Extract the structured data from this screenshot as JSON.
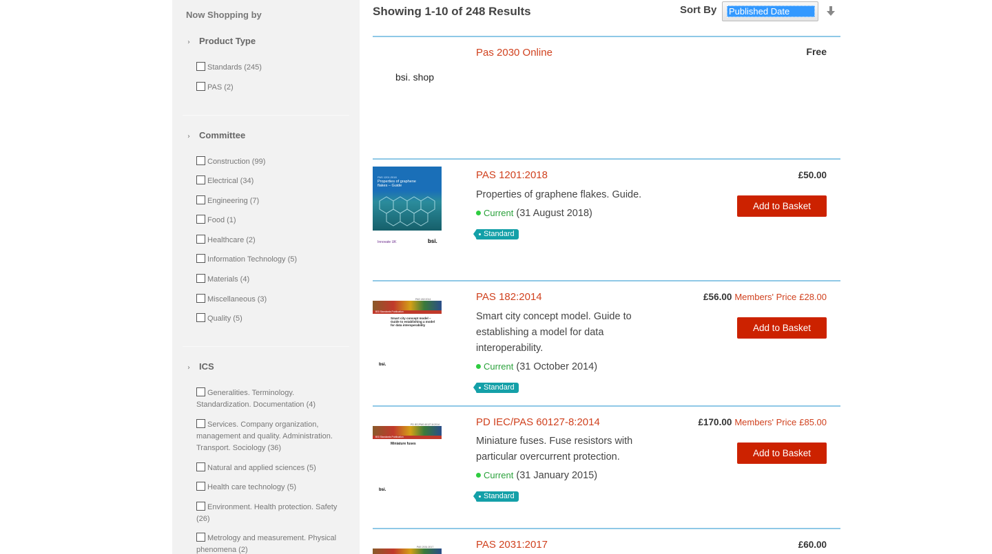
{
  "sidebar": {
    "heading": "Now Shopping by",
    "facets": [
      {
        "title": "Product Type",
        "options": [
          "Standards (245)",
          "PAS (2)"
        ]
      },
      {
        "title": "Committee",
        "options": [
          "Construction (99)",
          "Electrical (34)",
          "Engineering (7)",
          "Food (1)",
          "Healthcare (2)",
          "Information Technology (5)",
          "Materials (4)",
          "Miscellaneous (3)",
          "Quality (5)"
        ]
      },
      {
        "title": "ICS",
        "options": [
          "Generalities. Terminology. Standardization. Documentation (4)",
          "Services. Company organization, management and quality. Administration. Transport. Sociology (36)",
          "Natural and applied sciences (5)",
          "Health care technology (5)",
          "Environment. Health protection. Safety (26)",
          "Metrology and measurement. Physical phenomena (2)"
        ]
      }
    ]
  },
  "header": {
    "results": "Showing 1-10 of 248 Results",
    "sort_label": "Sort By",
    "sort_value": "Published Date"
  },
  "results": [
    {
      "title": "Pas 2030 Online",
      "price": "Free",
      "thumb_text": "bsi. shop"
    },
    {
      "title": "PAS 1201:2018",
      "description": "Properties of graphene flakes. Guide.",
      "status": "Current",
      "date": "(31 August 2018)",
      "tag": "Standard",
      "price": "£50.00",
      "button": "Add to Basket",
      "thumb": {
        "code": "PAS 1201:2018",
        "title": "Properties of graphene flakes – Guide",
        "footer_left": "Innovate UK",
        "footer_right": "bsi."
      }
    },
    {
      "title": "PAS 182:2014",
      "description": "Smart city concept model. Guide to establishing a model for data interoperability.",
      "status": "Current",
      "date": "(31 October 2014)",
      "tag": "Standard",
      "price": "£56.00",
      "members_label": "Members' Price",
      "members_price": "£28.00",
      "button": "Add to Basket",
      "thumb": {
        "code": "PAS 182:2014",
        "band": "BSI Standards Publication",
        "title": "Smart city concept model – Guide to establishing a model for data interoperability",
        "footer_left": "bsi."
      }
    },
    {
      "title": "PD IEC/PAS 60127-8:2014",
      "description": "Miniature fuses. Fuse resistors with particular overcurrent protection.",
      "status": "Current",
      "date": "(31 January 2015)",
      "tag": "Standard",
      "price": "£170.00",
      "members_label": "Members' Price",
      "members_price": "£85.00",
      "button": "Add to Basket",
      "thumb": {
        "code": "PD IEC/PAS 60127-8:2014",
        "band": "BSI Standards Publication",
        "title": "Miniature fuses",
        "footer_left": "bsi."
      }
    },
    {
      "title": "PAS 2031:2017",
      "price": "£60.00",
      "thumb": {
        "code": "PAS 2031:2017"
      }
    }
  ]
}
